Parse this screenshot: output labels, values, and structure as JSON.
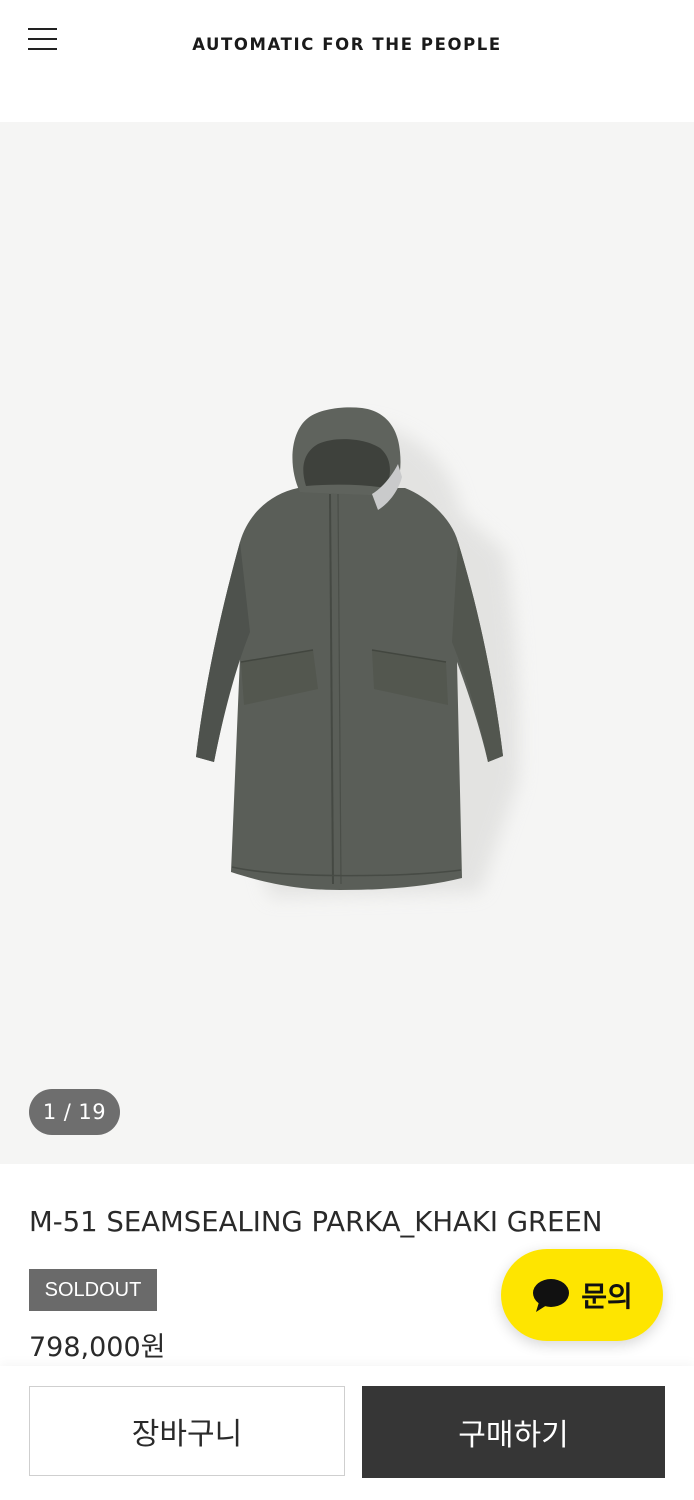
{
  "header": {
    "brand": "AUTOMATIC FOR THE PEOPLE"
  },
  "gallery": {
    "current": "1",
    "separator": "/",
    "total": "19"
  },
  "product": {
    "title": "M-51 SEAMSEALING PARKA_KHAKI GREEN",
    "status_badge": "SOLDOUT",
    "price": "798,000원"
  },
  "chat": {
    "label": "문의",
    "color": "#fee500"
  },
  "actions": {
    "cart_label": "장바구니",
    "buy_label": "구매하기"
  }
}
